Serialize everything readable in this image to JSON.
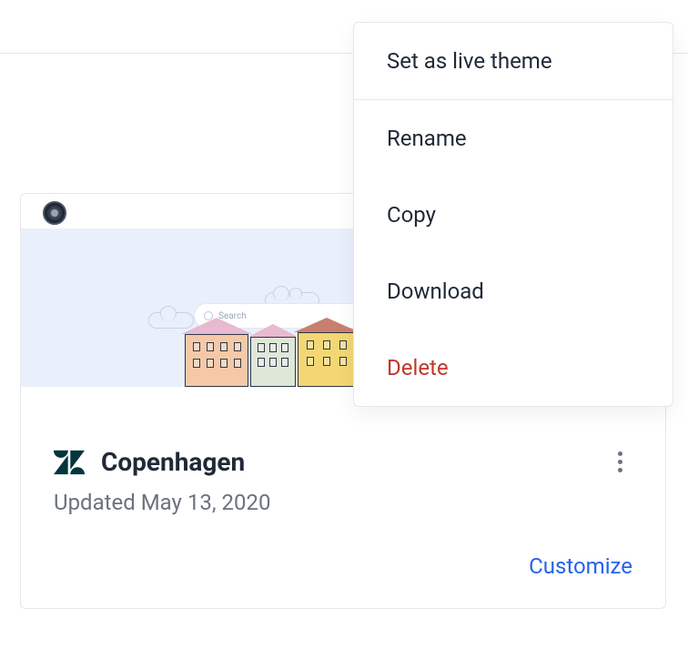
{
  "dropdown": {
    "set_live": "Set as live theme",
    "rename": "Rename",
    "copy": "Copy",
    "download": "Download",
    "delete": "Delete"
  },
  "theme_card": {
    "search_placeholder": "Search",
    "title": "Copenhagen",
    "updated": "Updated May 13, 2020",
    "customize": "Customize"
  }
}
